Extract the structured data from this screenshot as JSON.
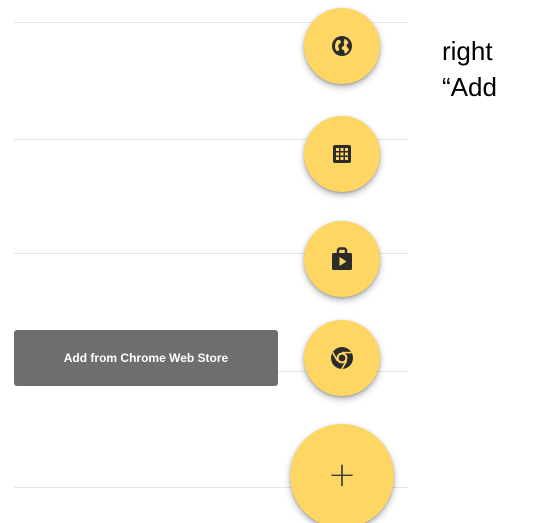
{
  "fab_menu": {
    "actions": [
      {
        "icon": "globe-icon"
      },
      {
        "icon": "grid-apps-icon"
      },
      {
        "icon": "play-store-bag-icon"
      },
      {
        "icon": "chrome-icon"
      }
    ],
    "main_label": "+",
    "tooltip": "Add from Chrome Web Store"
  },
  "side_text": {
    "line1": "right",
    "line2": "“Add"
  },
  "colors": {
    "fab": "#fdd663",
    "icon": "#2b2b2b",
    "tooltip_bg": "#6e6e6e",
    "tooltip_text": "#ffffff",
    "divider": "#e6e6e6"
  }
}
